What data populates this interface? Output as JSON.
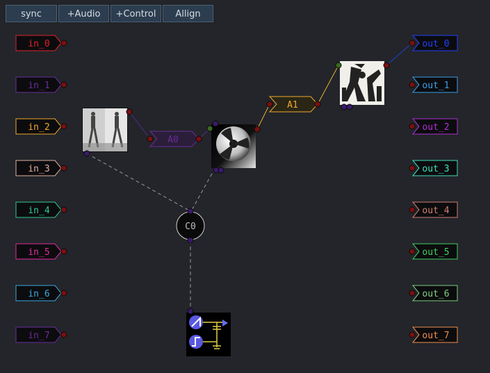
{
  "toolbar": {
    "sync_label": "sync",
    "add_audio_label": "+Audio",
    "add_control_label": "+Control",
    "align_label": "Allign"
  },
  "inputs": [
    {
      "label": "in_0",
      "color": "#e0202a"
    },
    {
      "label": "in_1",
      "color": "#6a2c9a"
    },
    {
      "label": "in_2",
      "color": "#f0a830"
    },
    {
      "label": "in_3",
      "color": "#e0b0a0"
    },
    {
      "label": "in_4",
      "color": "#30c890"
    },
    {
      "label": "in_5",
      "color": "#e02aa0"
    },
    {
      "label": "in_6",
      "color": "#3aa8e0"
    },
    {
      "label": "in_7",
      "color": "#6a2c9a"
    }
  ],
  "outputs": [
    {
      "label": "out_0",
      "color": "#2040ff"
    },
    {
      "label": "out_1",
      "color": "#3aa0e8"
    },
    {
      "label": "out_2",
      "color": "#b030d8"
    },
    {
      "label": "out_3",
      "color": "#40e0c0"
    },
    {
      "label": "out_4",
      "color": "#d08070"
    },
    {
      "label": "out_5",
      "color": "#40d060"
    },
    {
      "label": "out_6",
      "color": "#80d080"
    },
    {
      "label": "out_7",
      "color": "#f09050"
    }
  ],
  "nodes": {
    "a0": {
      "label": "A0",
      "color": "#6a2c9a"
    },
    "a1": {
      "label": "A1",
      "color": "#f0a830"
    },
    "c0": {
      "label": "C0"
    }
  },
  "colors": {
    "port_red": "#7a1010",
    "port_purple": "#3a1a6a",
    "port_green": "#3a6a20",
    "wire_a0": "#5a2a90",
    "wire_a1": "#e8b030",
    "wire_out0": "#2040d0",
    "wire_control": "#9a9a9a"
  },
  "icons": {
    "video_node": "walking-figures-icon",
    "disk_node": "reel-disk-icon",
    "engraving_node": "engraving-icon",
    "oscillator_node": "waveform-generator-icon"
  }
}
